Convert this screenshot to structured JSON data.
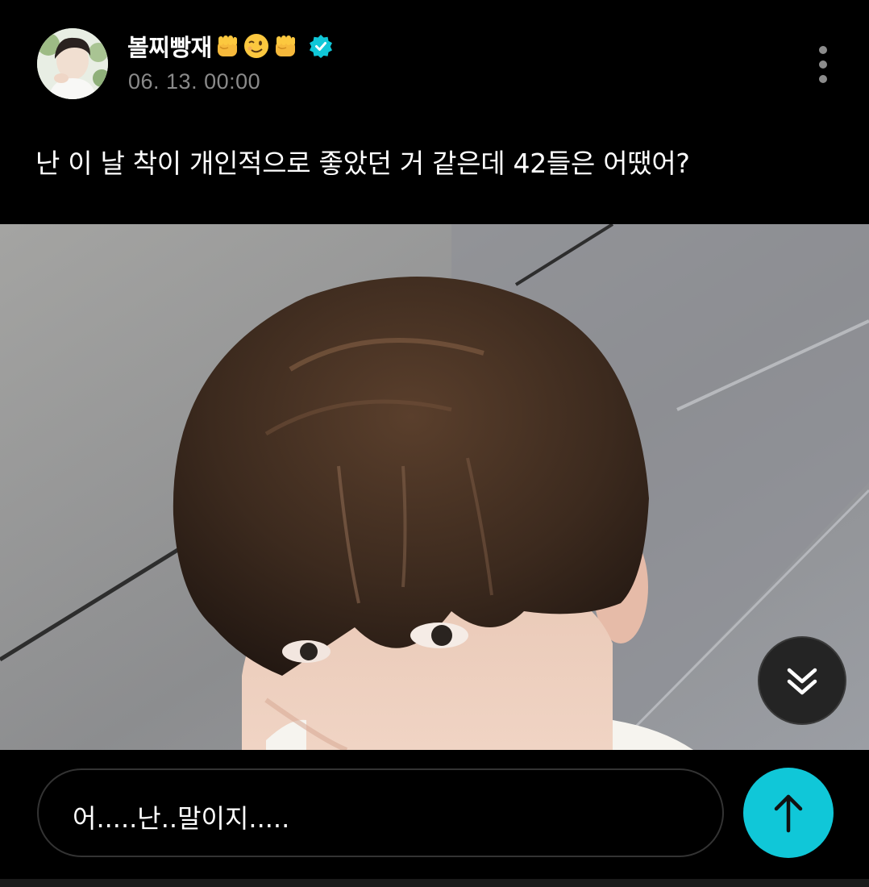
{
  "post": {
    "author_name": "볼찌빵재",
    "author_emoji": [
      "raised-fist",
      "winking-face",
      "raised-fist"
    ],
    "verified": true,
    "timestamp": "06. 13. 00:00",
    "text": "난 이 날 착이 개인적으로 좋았던 거 같은데 42들은 어땠어?"
  },
  "reply": {
    "value": "어.....난..말이지....."
  },
  "icons": {
    "more": "more-vertical-icon",
    "scroll_down": "double-chevron-down-icon",
    "send": "arrow-up-icon",
    "verified": "verified-badge-icon"
  },
  "colors": {
    "background": "#000000",
    "accent": "#10c7d8",
    "timestamp": "#8a8a8a"
  }
}
